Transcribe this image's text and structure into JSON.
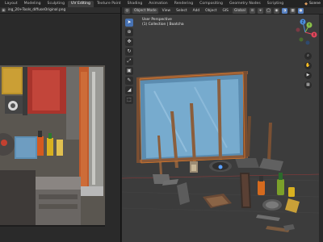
{
  "workspace_tabs": [
    "Layout",
    "Modeling",
    "Sculpting",
    "UV Editing",
    "Texture Paint",
    "Shading",
    "Animation",
    "Rendering",
    "Compositing",
    "Geometry Nodes",
    "Scripting"
  ],
  "active_tab": "UV Editing",
  "scene": {
    "label": "Scene"
  },
  "image_editor": {
    "image_name": "ing_20+Tools_diffuseOriginal.png"
  },
  "viewport": {
    "mode": "Object Mode",
    "menus": [
      "View",
      "Select",
      "Add",
      "Object",
      "GIS"
    ],
    "transform_orientation": "Global",
    "info_line1": "User Perspective",
    "info_line2": "(1) Collection | Boatcha"
  },
  "gizmo": {
    "x": "X",
    "y": "Y",
    "z": "Z"
  },
  "colors": {
    "accent": "#4772b3",
    "x_axis": "#e2465c",
    "y_axis": "#8bc34a",
    "z_axis": "#4c8fe0"
  }
}
